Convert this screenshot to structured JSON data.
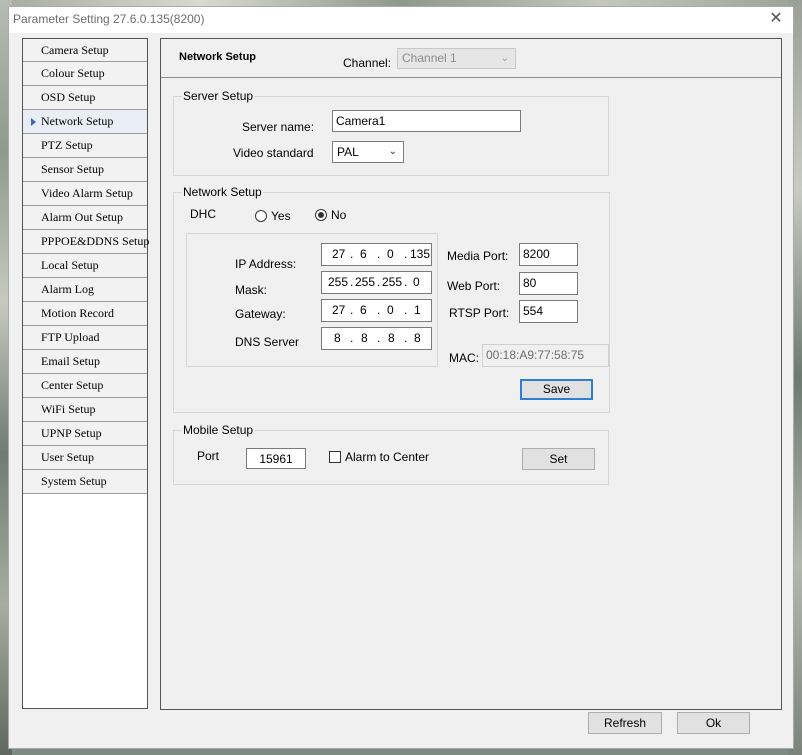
{
  "window": {
    "title": "Parameter Setting 27.6.0.135(8200)",
    "close_glyph": "✕"
  },
  "sidebar": {
    "items": [
      {
        "label": "Camera Setup"
      },
      {
        "label": "Colour Setup"
      },
      {
        "label": "OSD Setup"
      },
      {
        "label": "Network Setup"
      },
      {
        "label": "PTZ Setup"
      },
      {
        "label": "Sensor Setup"
      },
      {
        "label": "Video Alarm Setup"
      },
      {
        "label": "Alarm Out Setup"
      },
      {
        "label": "PPPOE&DDNS Setup"
      },
      {
        "label": "Local Setup"
      },
      {
        "label": "Alarm Log"
      },
      {
        "label": "Motion Record"
      },
      {
        "label": "FTP Upload"
      },
      {
        "label": "Email Setup"
      },
      {
        "label": "Center Setup"
      },
      {
        "label": "WiFi Setup"
      },
      {
        "label": "UPNP Setup"
      },
      {
        "label": "User Setup"
      },
      {
        "label": "System Setup"
      }
    ],
    "active": "Network Setup"
  },
  "header": {
    "title": "Network Setup",
    "channel_label": "Channel:",
    "channel_value": "Channel 1"
  },
  "server_setup": {
    "legend": "Server Setup",
    "server_name_label": "Server name:",
    "server_name_value": "Camera1",
    "video_standard_label": "Video standard",
    "video_standard_value": "PAL"
  },
  "network_setup": {
    "legend": "Network Setup",
    "dhcp_label": "DHCP",
    "yes_label": "Yes",
    "no_label": "No",
    "dhcp_selected": "No",
    "ip_label": "IP Address:",
    "ip": [
      "27",
      "6",
      "0",
      "135"
    ],
    "mask_label": "Mask:",
    "mask": [
      "255",
      "255",
      "255",
      "0"
    ],
    "gateway_label": "Gateway:",
    "gateway": [
      "27",
      "6",
      "0",
      "1"
    ],
    "dns_label": "DNS Server",
    "dns": [
      "8",
      "8",
      "8",
      "8"
    ],
    "dot": ".",
    "media_port_label": "Media Port:",
    "media_port": "8200",
    "web_port_label": "Web Port:",
    "web_port": "80",
    "rtsp_port_label": "RTSP Port:",
    "rtsp_port": "554",
    "mac_label": "MAC:",
    "mac": "00:18:A9:77:58:75",
    "save_label": "Save"
  },
  "mobile_setup": {
    "legend": "Mobile Setup",
    "port_label": "Port",
    "port": "15961",
    "alarm_label": "Alarm to Center",
    "alarm_checked": false,
    "set_label": "Set"
  },
  "footer": {
    "refresh_label": "Refresh",
    "ok_label": "Ok"
  },
  "colors": {
    "accent": "#2f7fd0",
    "active_marker": "#3a6ab0"
  },
  "icons": {
    "select_chevron": "chevron-down-icon",
    "menu_marker": "triangle-right-icon"
  }
}
